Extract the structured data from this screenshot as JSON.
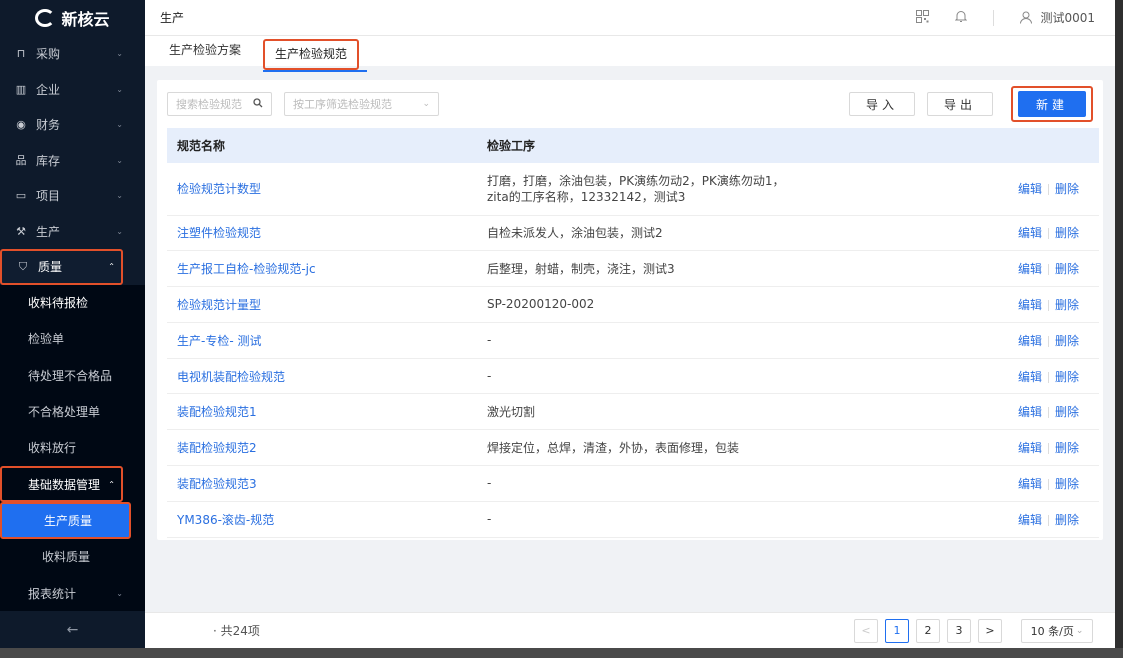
{
  "sidebar": {
    "logo": "新核云",
    "menu": [
      {
        "label": "采购",
        "icon": "cart-icon"
      },
      {
        "label": "企业",
        "icon": "building-icon"
      },
      {
        "label": "财务",
        "icon": "yen-icon"
      },
      {
        "label": "库存",
        "icon": "warehouse-icon"
      },
      {
        "label": "项目",
        "icon": "folder-icon"
      },
      {
        "label": "生产",
        "icon": "wrench-icon"
      },
      {
        "label": "质量",
        "icon": "shield-icon"
      }
    ],
    "quality_sub": [
      "收料待报检",
      "检验单",
      "待处理不合格品",
      "不合格处理单",
      "收料放行"
    ],
    "basic_data": "基础数据管理",
    "basic_sub": [
      "生产质量",
      "收料质量"
    ],
    "reports": "报表统计",
    "collapse_glyph": "←"
  },
  "topbar": {
    "title": "生产",
    "user": "测试0001"
  },
  "tabs": [
    "生产检验方案",
    "生产检验规范"
  ],
  "toolbar": {
    "search_placeholder": "搜索检验规范",
    "filter_placeholder": "按工序筛选检验规范",
    "import_label": "导入",
    "export_label": "导出",
    "new_label": "新建"
  },
  "table": {
    "headers": [
      "规范名称",
      "检验工序"
    ],
    "edit_label": "编辑",
    "delete_label": "删除",
    "rows": [
      {
        "name": "检验规范计数型",
        "process1": "打磨，打磨，涂油包装，PK演练勿动2，PK演练勿动1，",
        "process2": "zita的工序名称，12332142，测试3"
      },
      {
        "name": "注塑件检验规范",
        "process1": "自检未派发人，涂油包装，测试2",
        "process2": ""
      },
      {
        "name": "生产报工自检-检验规范-jc",
        "process1": "后整理，射蜡，制壳，浇注，测试3",
        "process2": ""
      },
      {
        "name": "检验规范计量型",
        "process1": "SP-20200120-002",
        "process2": ""
      },
      {
        "name": "生产-专检- 测试",
        "process1": "-",
        "process2": ""
      },
      {
        "name": "电视机装配检验规范",
        "process1": "-",
        "process2": ""
      },
      {
        "name": "装配检验规范1",
        "process1": "激光切割",
        "process2": ""
      },
      {
        "name": "装配检验规范2",
        "process1": "焊接定位，总焊，清渣，外协，表面修理，包装",
        "process2": ""
      },
      {
        "name": "装配检验规范3",
        "process1": "-",
        "process2": ""
      },
      {
        "name": "YM386-滚齿-规范",
        "process1": "-",
        "process2": ""
      }
    ]
  },
  "footer": {
    "total": "· 共24项",
    "pages": [
      "1",
      "2",
      "3"
    ],
    "prev": "<",
    "next": ">",
    "page_size": "10 条/页"
  },
  "colors": {
    "primary": "#1f6ff0",
    "sidebar_bg": "#0e1a2b",
    "highlight_box": "#e2502a"
  }
}
